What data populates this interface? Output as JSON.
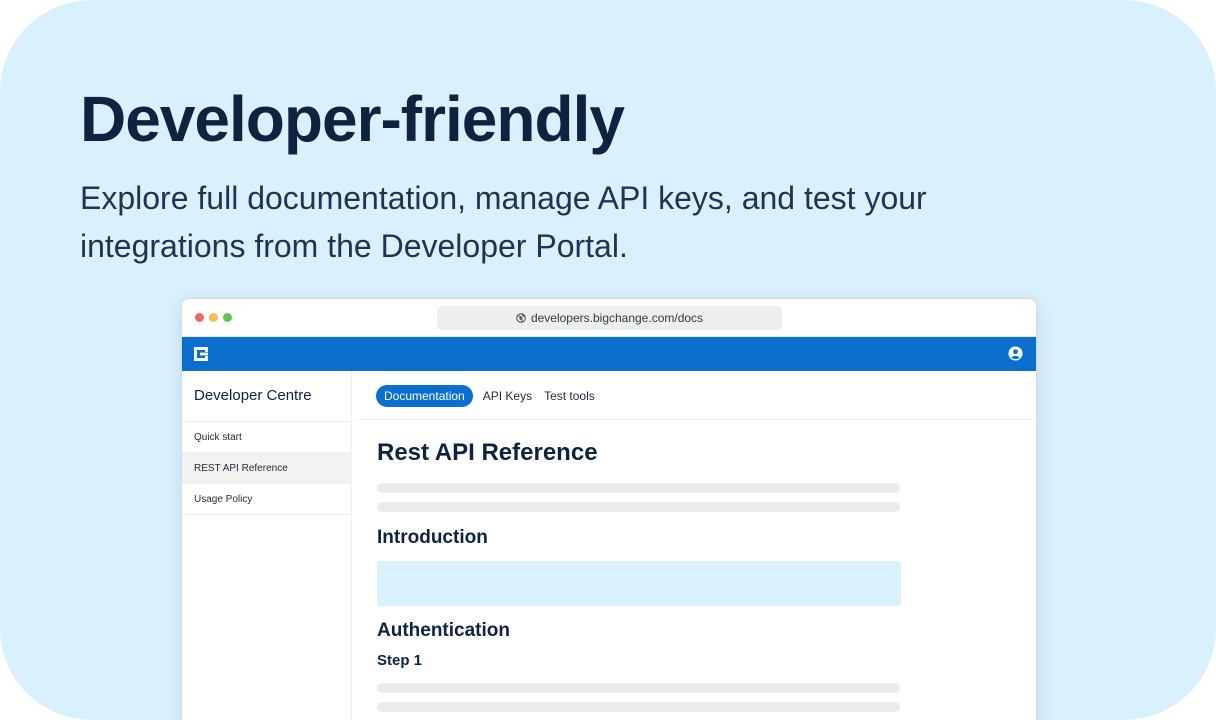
{
  "hero": {
    "title": "Developer-friendly",
    "subtitle": "Explore full documentation, manage API keys, and test your integrations from the Developer Portal."
  },
  "browser": {
    "url": "developers.bigchange.com/docs",
    "icons": [
      "globe-icon",
      "logo-icon",
      "user-icon"
    ]
  },
  "sidebar": {
    "title": "Developer Centre",
    "items": [
      {
        "label": "Quick start",
        "active": false
      },
      {
        "label": "REST API Reference",
        "active": true
      },
      {
        "label": "Usage Policy",
        "active": false
      }
    ]
  },
  "tabs": [
    {
      "label": "Documentation",
      "active": true
    },
    {
      "label": "API Keys",
      "active": false
    },
    {
      "label": "Test tools",
      "active": false
    }
  ],
  "main": {
    "title": "Rest API Reference",
    "sections": {
      "introduction": "Introduction",
      "authentication": "Authentication",
      "step1": "Step 1"
    }
  },
  "colors": {
    "background": "#d9f0fd",
    "brand": "#0a6fcf",
    "heading": "#0d2340"
  }
}
